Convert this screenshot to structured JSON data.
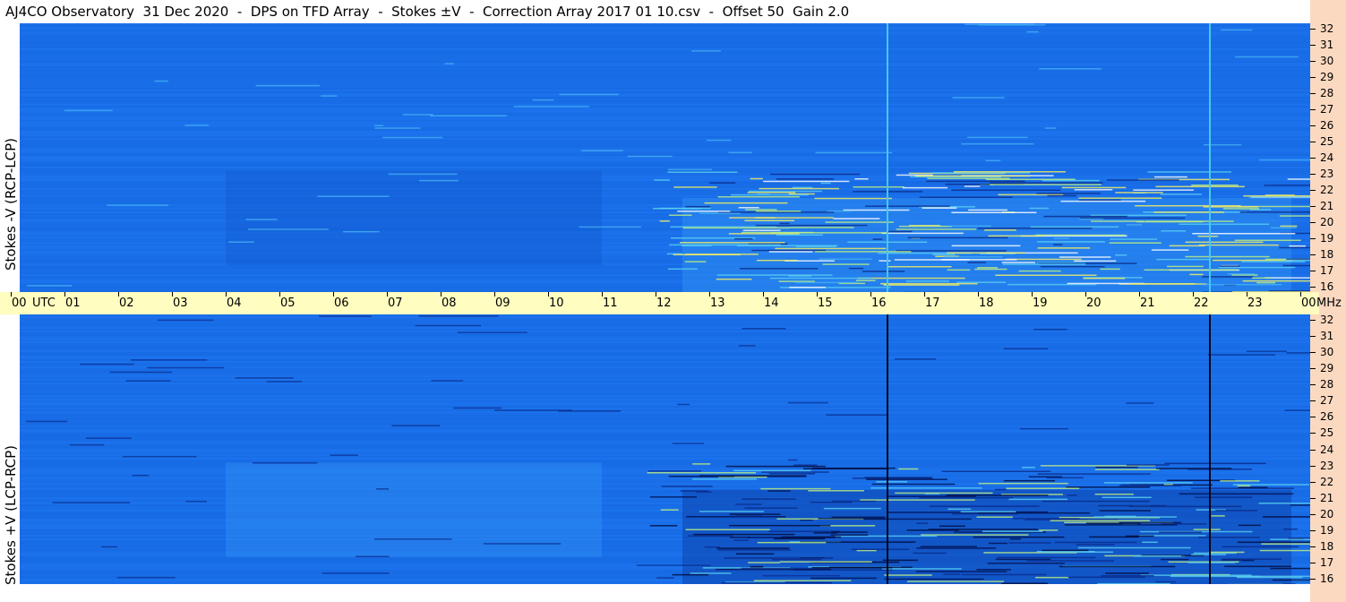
{
  "title": "AJ4CO Observatory  31 Dec 2020  -  DPS on TFD Array  -  Stokes ±V  -  Correction Array 2017 01 10.csv  -  Offset 50  Gain 2.0",
  "top_panel": {
    "label": "Stokes -V (RCP-LCP)"
  },
  "bottom_panel": {
    "label": "Stokes +V (LCP-RCP)"
  },
  "time_axis": {
    "labels": [
      "00",
      "01",
      "02",
      "03",
      "04",
      "05",
      "06",
      "07",
      "08",
      "09",
      "10",
      "11",
      "12",
      "13",
      "14",
      "15",
      "16",
      "17",
      "18",
      "19",
      "20",
      "21",
      "22",
      "23",
      "00"
    ],
    "utc_label": "UTC",
    "mhz_label": "MHz"
  },
  "freq_axis": {
    "labels": [
      "32",
      "31",
      "30",
      "29",
      "28",
      "27",
      "26",
      "25",
      "24",
      "23",
      "22",
      "21",
      "20",
      "19",
      "18",
      "17",
      "16"
    ]
  },
  "colors": {
    "background_blue": "#1a6ee8",
    "time_bar": "#fffdc0",
    "freq_bar": "#fbd9c0"
  }
}
